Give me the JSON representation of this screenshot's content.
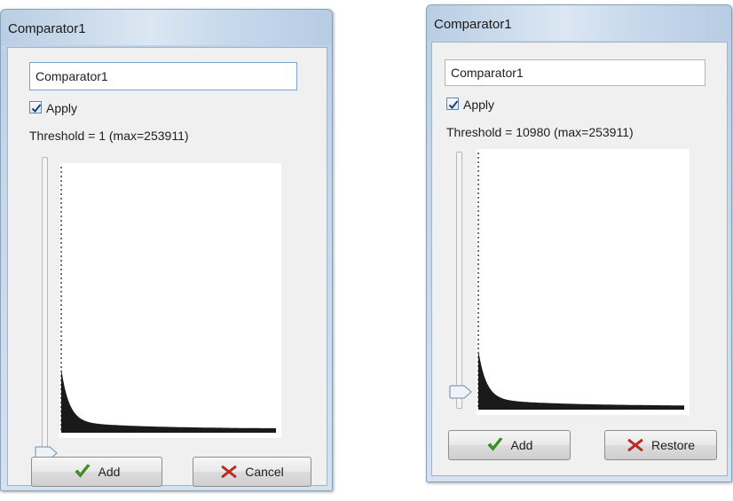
{
  "dialogs": [
    {
      "title": "Comparator1",
      "name_value": "Comparator1",
      "apply_label": "Apply",
      "apply_checked": true,
      "threshold_text": "Threshold = 1 (max=253911)",
      "threshold": 1,
      "threshold_max": 253911,
      "slider_level": 0,
      "buttons": {
        "primary": "Add",
        "secondary": "Cancel"
      },
      "icons": {
        "primary": "checkmark-icon",
        "secondary": "cross-icon"
      }
    },
    {
      "title": "Comparator1",
      "name_value": "Comparator1",
      "apply_label": "Apply",
      "apply_checked": true,
      "threshold_text": "Threshold = 10980 (max=253911)",
      "threshold": 10980,
      "threshold_max": 253911,
      "slider_level": 0.043,
      "buttons": {
        "primary": "Add",
        "secondary": "Restore"
      },
      "icons": {
        "primary": "checkmark-icon",
        "secondary": "cross-icon"
      }
    }
  ],
  "colors": {
    "histogram_fill": "#1a1a1a",
    "check_green": "#3b9a1e",
    "cross_red": "#c62a1c",
    "title_bar": "#c9d9ea"
  }
}
